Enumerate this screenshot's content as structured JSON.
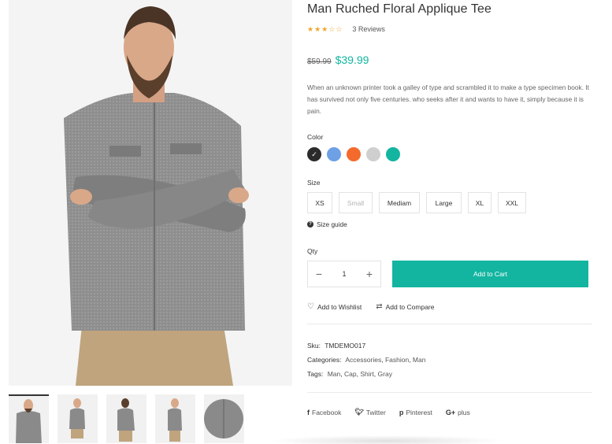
{
  "product": {
    "title": "Man Ruched Floral Applique Tee",
    "rating": 3,
    "rating_max": 5,
    "reviews_label": "3 Reviews",
    "old_price": "$59.99",
    "new_price": "$39.99",
    "description": "When an unknown printer took a galley of type and scrambled it to make a type specimen book. It has survived not only five centuries. who seeks after it and wants to have it, simply because it is pain."
  },
  "color": {
    "label": "Color",
    "swatches": [
      "#2b2b2b",
      "#6ea0e6",
      "#f46a2d",
      "#cfcfcf",
      "#13b5a0"
    ],
    "selected_index": 0
  },
  "size": {
    "label": "Size",
    "options": [
      "XS",
      "Small",
      "Mediam",
      "Large",
      "XL",
      "XXL"
    ],
    "disabled": [
      "Small"
    ],
    "guide_label": "Size guide"
  },
  "qty": {
    "label": "Qty",
    "value": "1",
    "minus": "−",
    "plus": "+"
  },
  "cart": {
    "add_label": "Add to Cart"
  },
  "actions": {
    "wishlist": "Add to Wishlist",
    "compare": "Add to Compare"
  },
  "meta": {
    "sku_key": "Sku:",
    "sku_value": "TMDEMO017",
    "categories_key": "Categories:",
    "categories": [
      "Accessories",
      "Fashion",
      "Man"
    ],
    "tags_key": "Tags:",
    "tags": [
      "Man",
      "Cap",
      "Shirt",
      "Gray"
    ]
  },
  "share": {
    "facebook": "Facebook",
    "twitter": "Twitter",
    "pinterest": "Pinterest",
    "plus": "plus"
  },
  "colors": {
    "accent": "#13b5a0",
    "star": "#f0a52a"
  },
  "icons": [
    "heart-icon",
    "compare-icon",
    "question-icon",
    "facebook-icon",
    "twitter-icon",
    "pinterest-icon",
    "google-plus-icon"
  ]
}
